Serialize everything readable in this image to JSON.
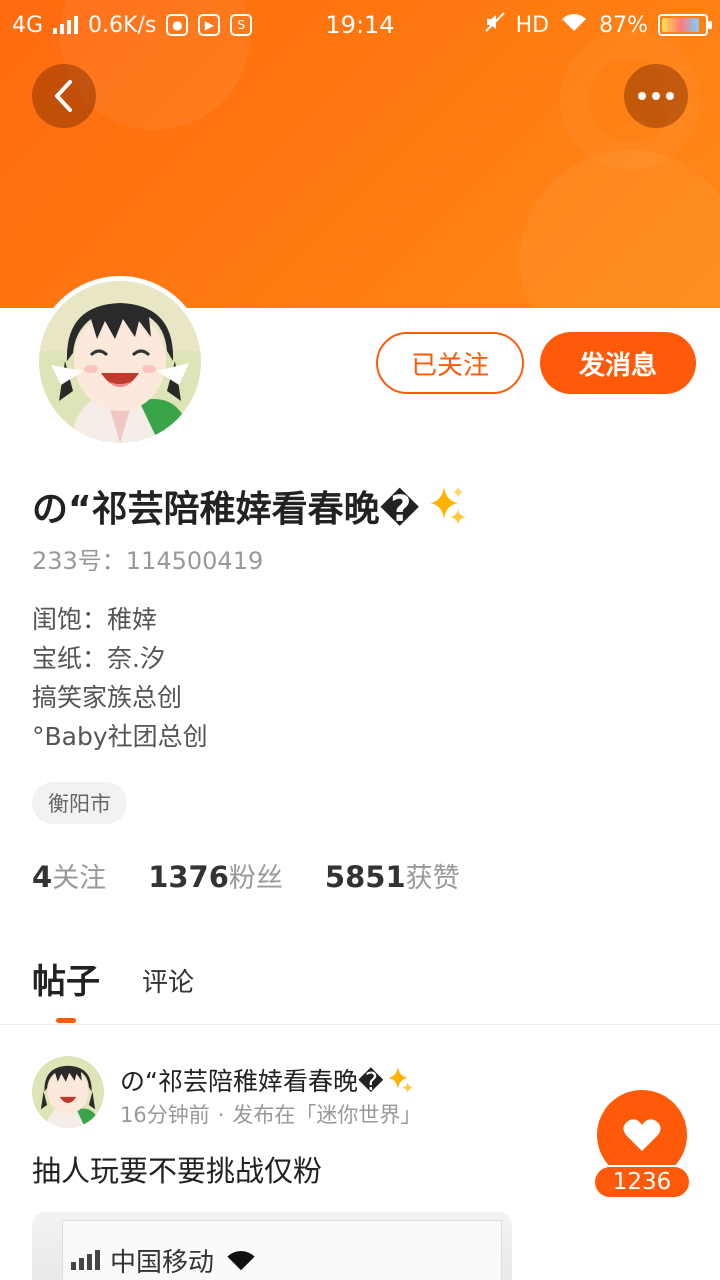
{
  "statusbar": {
    "network": "4G",
    "speed": "0.6K/s",
    "time": "19:14",
    "hd": "HD",
    "battery": "87%"
  },
  "header": {
    "back_icon": "chevron-left-icon",
    "more_icon": "more-dots-icon"
  },
  "profile": {
    "name": "の“祁芸陪稚婞看春晚�",
    "uid": "233号：114500419",
    "bio": [
      "闺饱：稚婞",
      "宝纸：奈.汐",
      "搞笑家族总创",
      "°Baby社团总创"
    ],
    "city": "衡阳市",
    "stats": [
      {
        "num": "4",
        "label": "关注"
      },
      {
        "num": "1376",
        "label": "粉丝"
      },
      {
        "num": "5851",
        "label": "获赞"
      }
    ]
  },
  "actions": {
    "followed_label": "已关注",
    "message_label": "发消息"
  },
  "tabs": {
    "posts": "帖子",
    "comments": "评论"
  },
  "post": {
    "author": "の“祁芸陪稚婞看春晚�",
    "time": "16分钟前",
    "dot": "·",
    "location": "发布在「迷你世界」",
    "title": "抽人玩要不要挑战仅粉",
    "image_text": "中国移动"
  },
  "like": {
    "count": "1236"
  },
  "colors": {
    "accent": "#ff5a0a",
    "banner": "#ff7a10"
  }
}
